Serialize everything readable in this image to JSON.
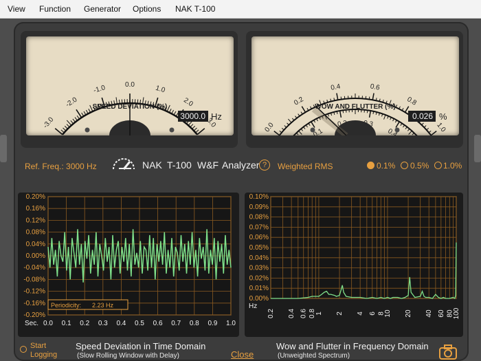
{
  "menu": [
    "View",
    "Function",
    "Generator",
    "Options",
    "NAK T-100"
  ],
  "speed_meter": {
    "title": "SPEED DEVIATION (%)",
    "scale_labels": [
      "-3.0",
      "-2.0",
      "-1.0",
      "0.0",
      "1.0",
      "2.0",
      "3.0"
    ],
    "needle_value": 0.0,
    "readout": "3000.0",
    "unit": "Hz"
  },
  "wf_meter": {
    "title": "WOW AND FLUTTER (%)",
    "outer_labels": [
      "0.0",
      "0.2",
      "0.4",
      "0.6",
      "0.8",
      "1.0"
    ],
    "inner_labels": [
      "0.0",
      "0.1",
      "0.2",
      "0.3",
      "0.4",
      "0.5"
    ],
    "readout": "0.026",
    "unit": "%"
  },
  "info": {
    "ref_freq": "Ref. Freq.: 3000 Hz",
    "brand": [
      "NAK",
      "T-100",
      "W&F",
      "Analyzer"
    ],
    "help": "?",
    "weighting": "Weighted RMS",
    "range_options": [
      "0.1%",
      "0.5%",
      "1.0%"
    ],
    "range_selected": "0.1%"
  },
  "time_plot": {
    "title": "Speed Deviation in Time Domain",
    "subtitle": "(Slow Rolling Window with Delay)",
    "y_ticks": [
      "0.20%",
      "0.16%",
      "0.12%",
      "0.08%",
      "0.04%",
      "0.00%",
      "-0.04%",
      "-0.08%",
      "-0.12%",
      "-0.16%",
      "-0.20%"
    ],
    "x_axis_label": "Sec.",
    "x_ticks": [
      "0.0",
      "0.1",
      "0.2",
      "0.3",
      "0.4",
      "0.5",
      "0.6",
      "0.7",
      "0.8",
      "0.9",
      "1.0"
    ],
    "periodicity_label": "Periodicity:",
    "periodicity_value": "2.23 Hz"
  },
  "freq_plot": {
    "title": "Wow and Flutter in Frequency Domain",
    "subtitle": "(Unweighted Spectrum)",
    "y_ticks": [
      "0.10%",
      "0.09%",
      "0.08%",
      "0.07%",
      "0.06%",
      "0.05%",
      "0.04%",
      "0.03%",
      "0.02%",
      "0.01%",
      "0.00%"
    ],
    "x_axis_label": "Hz",
    "x_ticks": [
      "0.2",
      "0.4",
      "0.6",
      "0.8",
      "1",
      "2",
      "4",
      "6",
      "8",
      "10",
      "20",
      "40",
      "60",
      "80",
      "100"
    ]
  },
  "controls": {
    "start_logging_line1": "Start",
    "start_logging_line2": "Logging",
    "close": "Close"
  },
  "chart_data": [
    {
      "type": "line",
      "title": "Speed Deviation in Time Domain",
      "xlabel": "Sec.",
      "ylabel": "",
      "xlim": [
        0.0,
        1.0
      ],
      "ylim": [
        -0.2,
        0.2
      ],
      "grid": true,
      "series": [
        {
          "values": [
            0.03,
            -0.04,
            0.06,
            -0.03,
            0.02,
            -0.07,
            0.05,
            0.0,
            -0.02,
            0.08,
            -0.05,
            0.03,
            -0.08,
            0.06,
            0.01,
            -0.04,
            0.09,
            -0.03,
            0.04,
            -0.09,
            0.05,
            -0.01,
            0.07,
            -0.06,
            0.02,
            -0.03,
            0.08,
            -0.07,
            0.04,
            0.0,
            -0.05,
            0.06,
            -0.02,
            0.03,
            -0.08,
            0.07,
            -0.04,
            0.02,
            0.05,
            -0.06,
            0.03,
            -0.02,
            0.06,
            -0.05,
            0.04,
            -0.07,
            0.09,
            -0.03,
            0.01,
            -0.04,
            0.05,
            -0.06,
            0.03,
            0.02,
            -0.05,
            0.07,
            -0.04,
            0.06,
            -0.08,
            0.04,
            -0.02,
            0.05,
            -0.03,
            0.08,
            -0.06,
            0.02,
            -0.04,
            0.06,
            -0.07,
            0.03,
            0.01,
            -0.05,
            0.07,
            -0.02,
            0.04,
            -0.06,
            0.05,
            -0.03,
            0.08,
            -0.04,
            0.02,
            -0.07,
            0.06,
            -0.01,
            0.03,
            -0.05,
            0.09,
            -0.06,
            0.02,
            -0.03,
            0.06,
            -0.08,
            0.05,
            -0.02,
            0.04,
            -0.06,
            0.07,
            -0.03,
            0.02,
            -0.04
          ]
        }
      ]
    },
    {
      "type": "line",
      "title": "Wow and Flutter in Frequency Domain",
      "xlabel": "Hz",
      "ylabel": "",
      "xlim": [
        0.2,
        100
      ],
      "x_scale": "log",
      "ylim": [
        0.0,
        0.1
      ],
      "grid": true,
      "series": [
        {
          "x": [
            0.2,
            0.5,
            0.7,
            0.8,
            1.0,
            1.1,
            1.2,
            1.3,
            1.4,
            1.5,
            1.7,
            1.8,
            2.0,
            2.1,
            2.2,
            2.3,
            2.5,
            3.0,
            4.0,
            5.0,
            6.0,
            7.0,
            8.0,
            9.0,
            10.0,
            11.0,
            12.0,
            14.0,
            16.0,
            18.0,
            20.0,
            21.0,
            22.0,
            25.0,
            30.0,
            32.0,
            34.0,
            36.0,
            40.0,
            45.0,
            50.0,
            55.0,
            60.0,
            65.0,
            70.0,
            80.0,
            90.0,
            95.0,
            98.0,
            100.0
          ],
          "values": [
            0.0,
            0.0,
            0.001,
            0.002,
            0.002,
            0.004,
            0.006,
            0.007,
            0.004,
            0.004,
            0.003,
            0.002,
            0.003,
            0.008,
            0.013,
            0.006,
            0.002,
            0.001,
            0.001,
            0.0,
            0.001,
            0.0,
            0.001,
            0.0,
            0.001,
            0.0,
            0.001,
            0.001,
            0.0,
            0.001,
            0.003,
            0.021,
            0.006,
            0.001,
            0.002,
            0.007,
            0.002,
            0.001,
            0.001,
            0.0,
            0.004,
            0.001,
            0.0,
            0.001,
            0.0,
            0.0,
            0.001,
            0.0,
            0.003,
            0.055
          ]
        }
      ]
    }
  ]
}
